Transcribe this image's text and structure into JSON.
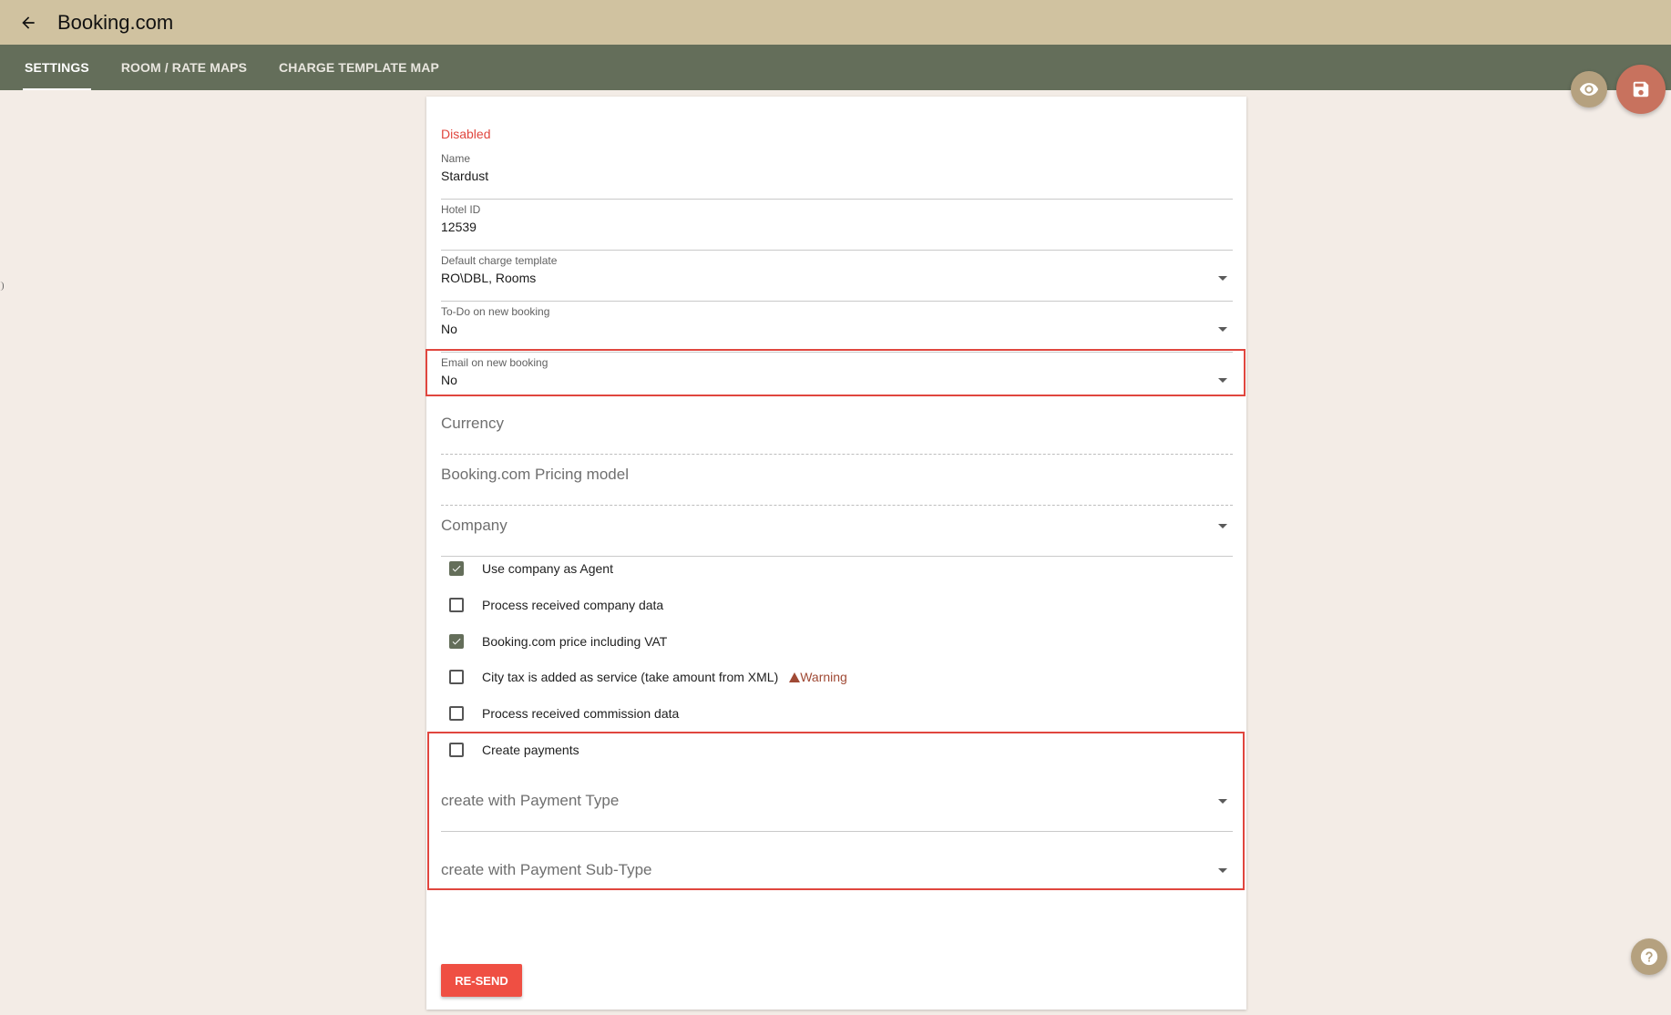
{
  "header": {
    "title": "Booking.com"
  },
  "tabs": [
    {
      "label": "SETTINGS",
      "active": true
    },
    {
      "label": "ROOM / RATE MAPS",
      "active": false
    },
    {
      "label": "CHARGE TEMPLATE MAP",
      "active": false
    }
  ],
  "form": {
    "status": "Disabled",
    "name": {
      "label": "Name",
      "value": "Stardust"
    },
    "hotel_id": {
      "label": "Hotel ID",
      "value": "12539"
    },
    "default_charge_template": {
      "label": "Default charge template",
      "value": "RO\\DBL, Rooms"
    },
    "todo_on_new_booking": {
      "label": "To-Do on new booking",
      "value": "No"
    },
    "email_on_new_booking": {
      "label": "Email on new booking",
      "value": "No"
    },
    "currency": {
      "placeholder": "Currency"
    },
    "pricing_model": {
      "placeholder": "Booking.com Pricing model"
    },
    "company": {
      "placeholder": "Company"
    },
    "checkboxes": [
      {
        "label": "Use company as Agent",
        "checked": true
      },
      {
        "label": "Process received company data",
        "checked": false
      },
      {
        "label": "Booking.com price including VAT",
        "checked": true
      },
      {
        "label": "City tax is added as service (take amount from XML)",
        "checked": false
      },
      {
        "label": "Process received commission data",
        "checked": false
      },
      {
        "label": "Create payments",
        "checked": false
      }
    ],
    "warning": "Warning",
    "payment_type": {
      "placeholder": "create with Payment Type"
    },
    "payment_subtype": {
      "placeholder": "create with Payment Sub-Type"
    },
    "resend_label": "RE-SEND"
  },
  "icons": {
    "back": "arrow-left-icon",
    "eye": "eye-icon",
    "save": "floppy-disk-icon",
    "help": "question-mark-icon"
  },
  "colors": {
    "topbar": "#d0c2a0",
    "tabbar": "#646e5a",
    "accent_red": "#e0463e",
    "button_red": "#ef4f43"
  }
}
